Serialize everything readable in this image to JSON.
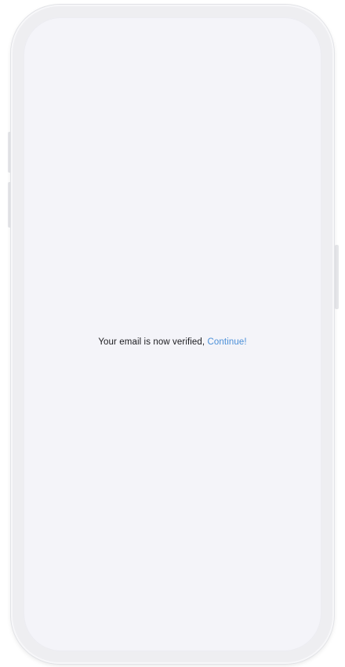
{
  "screen": {
    "message": "Your email is now verified,",
    "link_label": "Continue!"
  },
  "colors": {
    "background": "#f4f4f9",
    "text": "#1b1b1f",
    "link": "#4a8fd8"
  }
}
